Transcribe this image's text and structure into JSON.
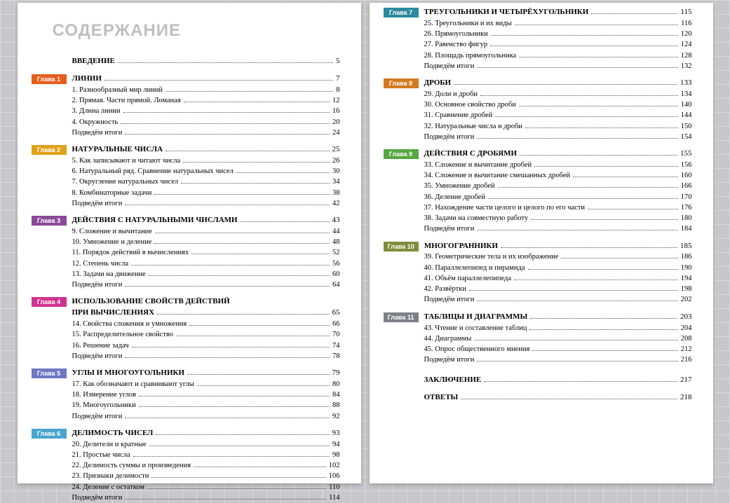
{
  "heading": "СОДЕРЖАНИЕ",
  "colors": {
    "1": "#e85c1c",
    "2": "#e0a21a",
    "3": "#8a4a97",
    "4": "#d0338e",
    "5": "#6f76c4",
    "6": "#4aa4d0",
    "7": "#2d8a9f",
    "8": "#d27a1f",
    "9": "#56a641",
    "10": "#7e8e3a",
    "11": "#7f7f88"
  },
  "intro": {
    "title": "ВВЕДЕНИЕ",
    "page": 5
  },
  "chapters_left": [
    {
      "n": 1,
      "badge": "Глава 1",
      "title": "ЛИНИИ",
      "page": 7,
      "items": [
        {
          "t": "1. Разнообразный мир линий",
          "p": 8
        },
        {
          "t": "2. Прямая. Части прямой. Ломаная",
          "p": 12
        },
        {
          "t": "3. Длина линии",
          "p": 16
        },
        {
          "t": "4. Окружность",
          "p": 20
        },
        {
          "t": "Подведём итоги",
          "p": 24
        }
      ]
    },
    {
      "n": 2,
      "badge": "Глава 2",
      "title": "НАТУРАЛЬНЫЕ ЧИСЛА",
      "page": 25,
      "items": [
        {
          "t": "5. Как записывают и читают числа",
          "p": 26
        },
        {
          "t": "6. Натуральный ряд. Сравнение натуральных чисел",
          "p": 30
        },
        {
          "t": "7. Округление натуральных чисел",
          "p": 34
        },
        {
          "t": "8. Комбинаторные задачи",
          "p": 38
        },
        {
          "t": "Подведём итоги",
          "p": 42
        }
      ]
    },
    {
      "n": 3,
      "badge": "Глава 3",
      "title": "ДЕЙСТВИЯ С НАТУРАЛЬНЫМИ ЧИСЛАМИ",
      "page": 43,
      "items": [
        {
          "t": "9. Сложение и вычитание",
          "p": 44
        },
        {
          "t": "10. Умножение и деление",
          "p": 48
        },
        {
          "t": "11. Порядок действий в вычислениях",
          "p": 52
        },
        {
          "t": "12. Степень числа",
          "p": 56
        },
        {
          "t": "13. Задачи на движение",
          "p": 60
        },
        {
          "t": "Подведём итоги",
          "p": 64
        }
      ]
    },
    {
      "n": 4,
      "badge": "Глава 4",
      "title": "ИСПОЛЬЗОВАНИЕ СВОЙСТВ ДЕЙСТВИЙ",
      "title2": "ПРИ ВЫЧИСЛЕНИЯХ",
      "page": 65,
      "items": [
        {
          "t": "14. Свойства сложения и умножения",
          "p": 66
        },
        {
          "t": "15. Распределительное свойство",
          "p": 70
        },
        {
          "t": "16. Решение задач",
          "p": 74
        },
        {
          "t": "Подведём итоги",
          "p": 78
        }
      ]
    },
    {
      "n": 5,
      "badge": "Глава 5",
      "title": "УГЛЫ И МНОГОУГОЛЬНИКИ",
      "page": 79,
      "items": [
        {
          "t": "17. Как обозначают и сравнивают углы",
          "p": 80
        },
        {
          "t": "18. Измерение углов",
          "p": 84
        },
        {
          "t": "19. Многоугольники",
          "p": 88
        },
        {
          "t": "Подведём итоги",
          "p": 92
        }
      ]
    },
    {
      "n": 6,
      "badge": "Глава 6",
      "title": "ДЕЛИМОСТЬ ЧИСЕЛ",
      "page": 93,
      "items": [
        {
          "t": "20. Делители и кратные",
          "p": 94
        },
        {
          "t": "21. Простые числа",
          "p": 98
        },
        {
          "t": "22. Делимость суммы и произведения",
          "p": 102
        },
        {
          "t": "23. Признаки делимости",
          "p": 106
        },
        {
          "t": "24. Деление с остатком",
          "p": 110
        },
        {
          "t": "Подведём итоги",
          "p": 114
        }
      ]
    }
  ],
  "chapters_right": [
    {
      "n": 7,
      "badge": "Глава 7",
      "title": "ТРЕУГОЛЬНИКИ И ЧЕТЫРЁХУГОЛЬНИКИ",
      "page": 115,
      "items": [
        {
          "t": "25. Треугольники и их виды",
          "p": 116
        },
        {
          "t": "26. Прямоугольники",
          "p": 120
        },
        {
          "t": "27. Равенство фигур",
          "p": 124
        },
        {
          "t": "28. Площадь прямоугольника",
          "p": 128
        },
        {
          "t": "Подведём итоги",
          "p": 132
        }
      ]
    },
    {
      "n": 8,
      "badge": "Глава 8",
      "title": "ДРОБИ",
      "page": 133,
      "items": [
        {
          "t": "29. Доли и дроби",
          "p": 134
        },
        {
          "t": "30. Основное свойство дроби",
          "p": 140
        },
        {
          "t": "31. Сравнение дробей",
          "p": 144
        },
        {
          "t": "32. Натуральные числа и дроби",
          "p": 150
        },
        {
          "t": "Подведём итоги",
          "p": 154
        }
      ]
    },
    {
      "n": 9,
      "badge": "Глава 9",
      "title": "ДЕЙСТВИЯ С ДРОБЯМИ",
      "page": 155,
      "items": [
        {
          "t": "33. Сложение и вычитание дробей",
          "p": 156
        },
        {
          "t": "34. Сложение и вычитание смешанных дробей",
          "p": 160
        },
        {
          "t": "35. Умножение дробей",
          "p": 166
        },
        {
          "t": "36. Деление дробей",
          "p": 170
        },
        {
          "t": "37. Нахождение части целого и целого по его части",
          "p": 176
        },
        {
          "t": "38. Задачи на совместную работу",
          "p": 180
        },
        {
          "t": "Подведём итоги",
          "p": 184
        }
      ]
    },
    {
      "n": 10,
      "badge": "Глава 10",
      "title": "МНОГОГРАННИКИ",
      "page": 185,
      "items": [
        {
          "t": "39. Геометрические тела и их изображение",
          "p": 186
        },
        {
          "t": "40. Параллелепипед и пирамида",
          "p": 190
        },
        {
          "t": "41. Объём параллелепипеда",
          "p": 194
        },
        {
          "t": "42. Развёртки",
          "p": 198
        },
        {
          "t": "Подведём итоги",
          "p": 202
        }
      ]
    },
    {
      "n": 11,
      "badge": "Глава 11",
      "title": "ТАБЛИЦЫ И ДИАГРАММЫ",
      "page": 203,
      "items": [
        {
          "t": "43. Чтение и составление таблиц",
          "p": 204
        },
        {
          "t": "44. Диаграммы",
          "p": 208
        },
        {
          "t": "45. Опрос общественного мнения",
          "p": 212
        },
        {
          "t": "Подведём итоги",
          "p": 216
        }
      ]
    }
  ],
  "conclusion": {
    "title": "ЗАКЛЮЧЕНИЕ",
    "page": 217
  },
  "answers": {
    "title": "ОТВЕТЫ",
    "page": 218
  }
}
